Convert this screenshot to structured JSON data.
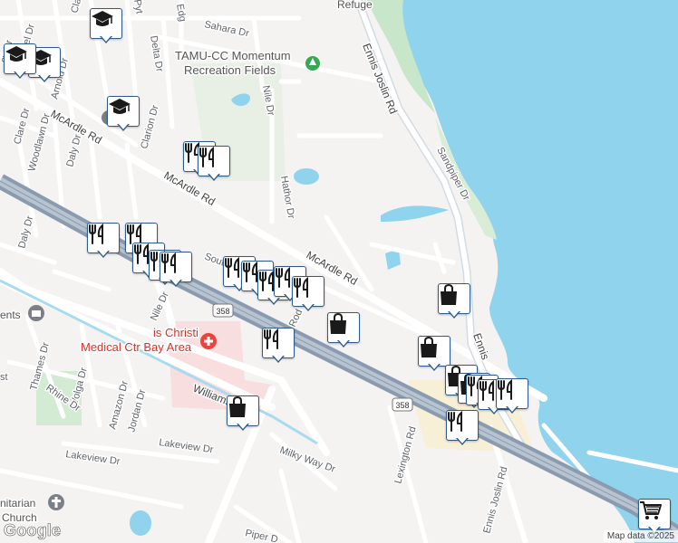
{
  "attribution": "Map data ©2025",
  "logo": "Google",
  "pois": {
    "refuge": "Refuge",
    "momentum_line1": "TAMU-CC Momentum",
    "momentum_line2": "Recreation Fields",
    "hospital_line1": "is Christi",
    "hospital_line2": "Medical Ctr Bay Area",
    "ents": "ents",
    "church_line1": "nitarian",
    "church_line2": "Church"
  },
  "highway_shield": "358",
  "streets": {
    "sahara": "Sahara Dr",
    "ennis_top": "Ennis Joslin Rd",
    "ennis_mid": "Ennis",
    "ennis_bottom": "Ennis Joslin Rd",
    "sandpiper": "Sandpiper Dr",
    "mcardle_left": "McArdle Rd",
    "mcardle_mid": "McArdle Rd",
    "mcardle_right": "McArdle Rd",
    "delta": "Delta Dr",
    "nile_top": "Nile Dr",
    "nile_bottom": "Nile Dr",
    "hathor": "Hathor Dr",
    "clare_top": "Clare Dr",
    "clare_left": "Clare Dr",
    "arnold": "Arnold Dr",
    "woodlawn": "Woodlawn Dr",
    "daly_top": "Daly Dr",
    "daly_left": "Daly Dr",
    "clarion": "Clarion Dr",
    "south": "South",
    "rod": "Rod",
    "thames": "Thames Dr",
    "volga": "Volga Dr",
    "rhine": "Rhine Dr",
    "amazon": "Amazon Dr",
    "jordan": "Jordan Dr",
    "williams": "Williams",
    "lakeview_left": "Lakeview Dr",
    "lakeview_right": "Lakeview Dr",
    "milky_way": "Milky Way Dr",
    "piper": "Piper D",
    "lexington": "Lexington Rd",
    "pyt": "Pyt",
    "edg": "Edg",
    "el_dr": "el Dr",
    "cy_dr": "cy Dr",
    "st": "st"
  },
  "markers": [
    {
      "type": "school",
      "icon": "school-icon"
    },
    {
      "type": "school",
      "icon": "school-icon"
    },
    {
      "type": "school",
      "icon": "school-icon"
    },
    {
      "type": "school",
      "icon": "school-icon"
    },
    {
      "type": "shopping",
      "icon": "shopping-bag-icon"
    },
    {
      "type": "restaurant",
      "icon": "restaurant-icon"
    },
    {
      "type": "restaurant",
      "icon": "restaurant-icon"
    },
    {
      "type": "restaurant",
      "icon": "restaurant-icon"
    },
    {
      "type": "restaurant",
      "icon": "restaurant-icon"
    },
    {
      "type": "restaurant",
      "icon": "restaurant-icon"
    },
    {
      "type": "restaurant",
      "icon": "restaurant-icon"
    },
    {
      "type": "restaurant",
      "icon": "restaurant-icon"
    },
    {
      "type": "restaurant",
      "icon": "restaurant-icon"
    },
    {
      "type": "restaurant",
      "icon": "restaurant-icon"
    },
    {
      "type": "restaurant",
      "icon": "restaurant-icon"
    },
    {
      "type": "restaurant",
      "icon": "restaurant-icon"
    },
    {
      "type": "restaurant",
      "icon": "restaurant-icon"
    },
    {
      "type": "restaurant",
      "icon": "restaurant-icon"
    },
    {
      "type": "shopping",
      "icon": "shopping-bag-icon"
    },
    {
      "type": "shopping",
      "icon": "shopping-bag-icon"
    },
    {
      "type": "shopping",
      "icon": "shopping-bag-icon"
    },
    {
      "type": "shopping",
      "icon": "shopping-bag-icon"
    },
    {
      "type": "shopping",
      "icon": "shopping-bag-icon"
    },
    {
      "type": "restaurant",
      "icon": "restaurant-icon"
    },
    {
      "type": "restaurant",
      "icon": "restaurant-icon"
    },
    {
      "type": "restaurant",
      "icon": "restaurant-icon"
    },
    {
      "type": "restaurant",
      "icon": "restaurant-icon"
    },
    {
      "type": "shopping-cart",
      "icon": "shopping-cart-icon"
    }
  ]
}
